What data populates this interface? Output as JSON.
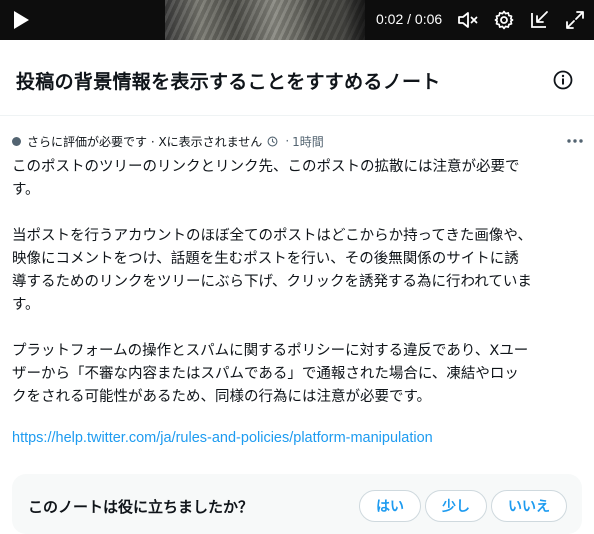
{
  "video": {
    "time_display": "0:02 / 0:06",
    "controls": [
      "play-icon",
      "volume-muted-icon",
      "settings-gear-icon",
      "minimize-icon",
      "fullscreen-icon"
    ]
  },
  "header": {
    "title": "投稿の背景情報を表示することをすすめるノート",
    "info_icon": "info-icon"
  },
  "note": {
    "status": "さらに評価が必要です · Xに表示されません",
    "time_ago": "1時間",
    "paragraphs": [
      "このポストのツリーのリンクとリンク先、このポストの拡散には注意が必要です。",
      "当ポストを行うアカウントのほぼ全てのポストはどこからか持ってきた画像や、映像にコメントをつけ、話題を生むポストを行い、その後無関係のサイトに誘導するためのリンクをツリーにぶら下げ、クリックを誘発する為に行われています。",
      "プラットフォームの操作とスパムに関するポリシーに対する違反であり、Xユーザーから「不審な内容またはスパムである」で通報された場合に、凍結やロックをされる可能性があるため、同様の行為には注意が必要です。"
    ],
    "link": "https://help.twitter.com/ja/rules-and-policies/platform-manipulation"
  },
  "rating": {
    "question": "このノートは役に立ちましたか？",
    "buttons": [
      "はい",
      "少し",
      "いいえ"
    ]
  },
  "colors": {
    "accent": "#1d9bf0",
    "text": "#0f1419",
    "muted": "#536471",
    "rating_bg": "#f7f9f9"
  }
}
